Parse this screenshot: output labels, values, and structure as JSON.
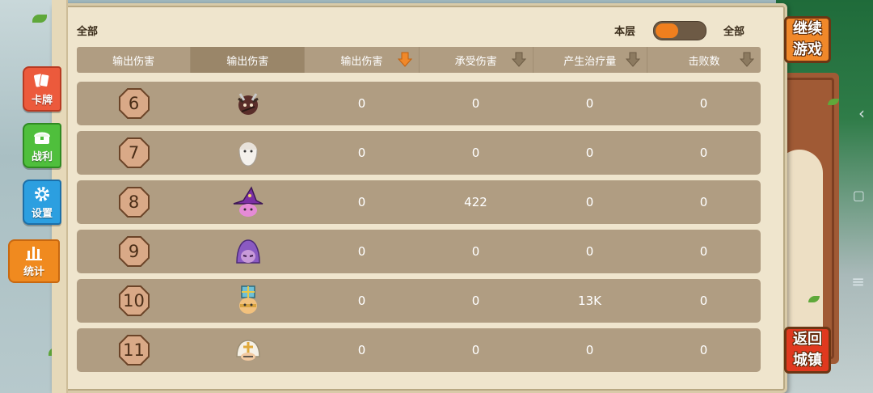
{
  "top_bar": {
    "left_filter": "全部",
    "toggle_label_left": "本层",
    "toggle_label_right": "全部"
  },
  "columns": [
    {
      "label": "输出伤害",
      "sortable": false,
      "selected": false
    },
    {
      "label": "输出伤害",
      "sortable": false,
      "selected": true
    },
    {
      "label": "输出伤害",
      "sortable": true,
      "active_sort": true
    },
    {
      "label": "承受伤害",
      "sortable": true,
      "active_sort": false
    },
    {
      "label": "产生治疗量",
      "sortable": true,
      "active_sort": false
    },
    {
      "label": "击败数",
      "sortable": true,
      "active_sort": false
    }
  ],
  "rows": [
    {
      "rank": "6",
      "hero_icon": "horned-warrior-icon",
      "damage_dealt": "0",
      "damage_taken": "0",
      "healing": "0",
      "kills": "0"
    },
    {
      "rank": "7",
      "hero_icon": "old-sage-icon",
      "damage_dealt": "0",
      "damage_taken": "0",
      "healing": "0",
      "kills": "0"
    },
    {
      "rank": "8",
      "hero_icon": "witch-icon",
      "damage_dealt": "0",
      "damage_taken": "422",
      "healing": "0",
      "kills": "0"
    },
    {
      "rank": "9",
      "hero_icon": "hooded-mage-icon",
      "damage_dealt": "0",
      "damage_taken": "0",
      "healing": "0",
      "kills": "0"
    },
    {
      "rank": "10",
      "hero_icon": "paladin-icon",
      "damage_dealt": "0",
      "damage_taken": "0",
      "healing": "13K",
      "kills": "0"
    },
    {
      "rank": "11",
      "hero_icon": "white-priest-icon",
      "damage_dealt": "0",
      "damage_taken": "0",
      "healing": "0",
      "kills": "0"
    }
  ],
  "side_menu": {
    "cards": "卡牌",
    "loot": "战利",
    "settings": "设置",
    "stats": "统计"
  },
  "actions": {
    "continue_line1": "继续",
    "continue_line2": "游戏",
    "return_line1": "返回",
    "return_line2": "城镇"
  },
  "colors": {
    "accent_orange": "#f0882a",
    "return_red": "#e0391f",
    "parchment": "#efe5cd",
    "row_bg": "#b09d82"
  }
}
